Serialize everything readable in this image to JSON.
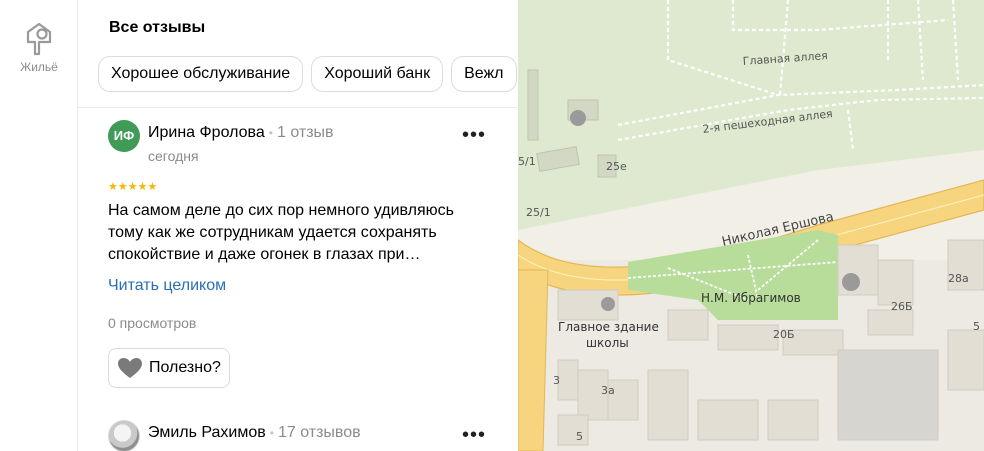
{
  "rail": {
    "item_label": "Жильё",
    "icon": "home-icon"
  },
  "reviews_section": {
    "title": "Все отзывы",
    "chips": [
      "Хорошее обслуживание",
      "Хороший банк",
      "Вежл"
    ]
  },
  "reviews": [
    {
      "avatar_initials": "ИФ",
      "name": "Ирина Фролова",
      "count": "1 отзыв",
      "date": "сегодня",
      "rating": 5,
      "stars": "★★★★★",
      "text": "На самом деле до сих пор немного удивляюсь тому как же сотрудникам удается сохранять спокойствие и даже огонек в глазах при…",
      "read_more": "Читать целиком",
      "views": "0 просмотров",
      "useful_label": "Полезно?"
    },
    {
      "name": "Эмиль Рахимов",
      "count": "17 отзывов"
    }
  ],
  "map": {
    "labels": {
      "main_alley": "Главная аллея",
      "second_alley": "2-я пешеходная аллея",
      "street": "Николая Ершова",
      "square": "Н.М. Ибрагимов",
      "school": "Главное здание",
      "school2": "школы",
      "b25e": "25е",
      "b25_1": "25/1",
      "b5_1": "5/1",
      "b20b": "20Б",
      "b26b": "26Б",
      "b28a": "28а",
      "b3": "3",
      "b3a": "3а",
      "b5": "5",
      "b5r": "5"
    },
    "colors": {
      "forest": "#dfe9cf",
      "road": "#f7d57f",
      "road_edge": "#e3b755",
      "park": "#b8dc9a",
      "building": "#e3ded4"
    }
  }
}
